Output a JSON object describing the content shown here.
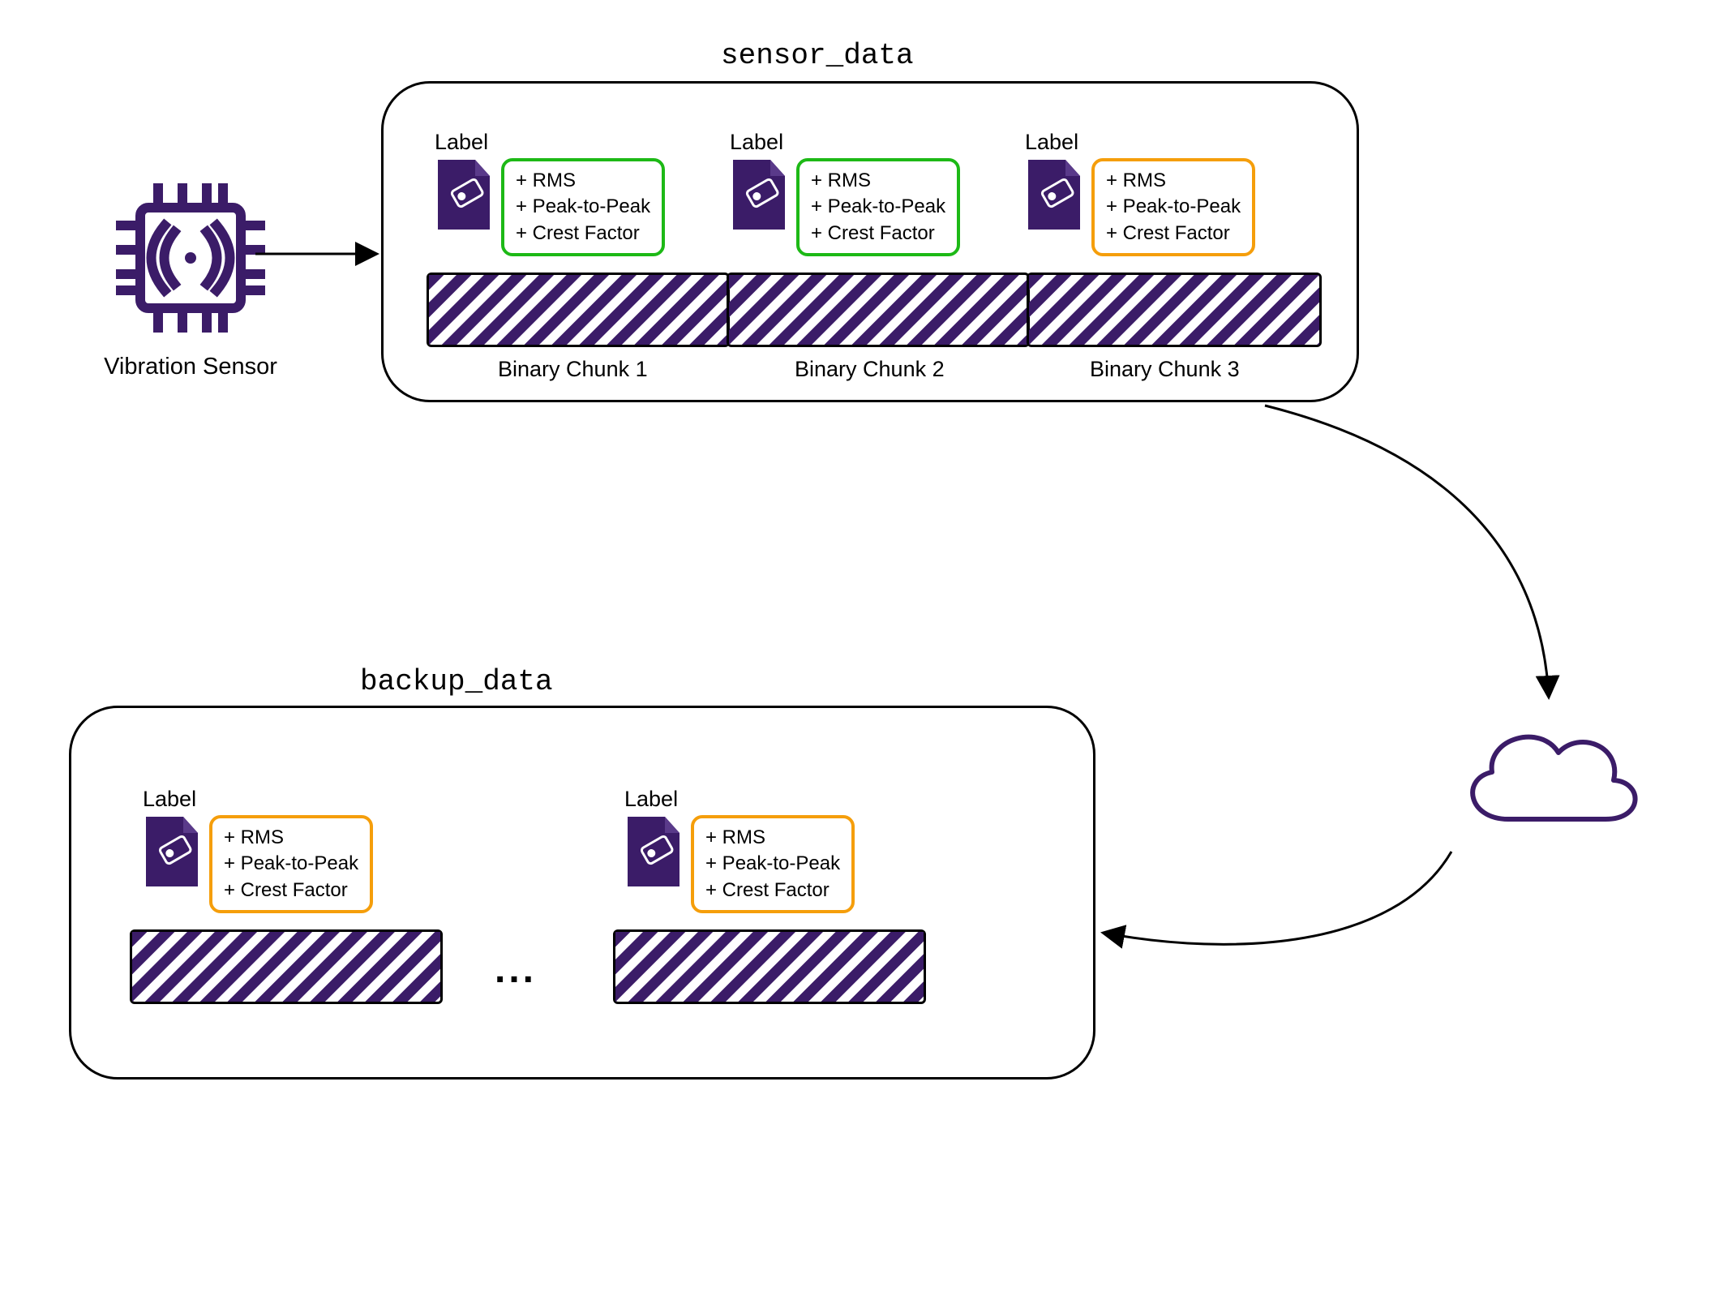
{
  "sensor_label": "Vibration Sensor",
  "sensor_data_title": "sensor_data",
  "backup_data_title": "backup_data",
  "label_word": "Label",
  "metrics": [
    "+ RMS",
    "+ Peak-to-Peak",
    "+ Crest Factor"
  ],
  "chunk_captions": [
    "Binary Chunk 1",
    "Binary Chunk 2",
    "Binary Chunk 3"
  ],
  "ellipsis": "...",
  "colors": {
    "purple": "#3b1c68",
    "green": "#1db916",
    "orange": "#f59e0b"
  }
}
